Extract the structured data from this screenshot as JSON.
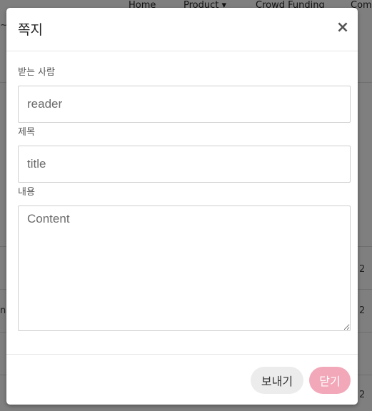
{
  "background": {
    "nav_items": [
      "Home",
      "Product ▾",
      "Crowd Funding",
      "Com"
    ],
    "row_numbers": [
      "2",
      "2",
      "2"
    ],
    "left_glyphs": [
      "~",
      "n"
    ]
  },
  "modal": {
    "title": "쪽지",
    "close_icon": "×",
    "fields": {
      "recipient_label": "받는 사람",
      "recipient_placeholder": "reader",
      "subject_label": "제목",
      "subject_placeholder": "title",
      "content_label": "내용",
      "content_placeholder": "Content"
    },
    "footer": {
      "send_label": "보내기",
      "close_label": "닫기"
    }
  },
  "colors": {
    "overlay": "#7f7f7f",
    "close_button_bg": "#f2a8b8",
    "send_button_bg": "#ececec"
  }
}
